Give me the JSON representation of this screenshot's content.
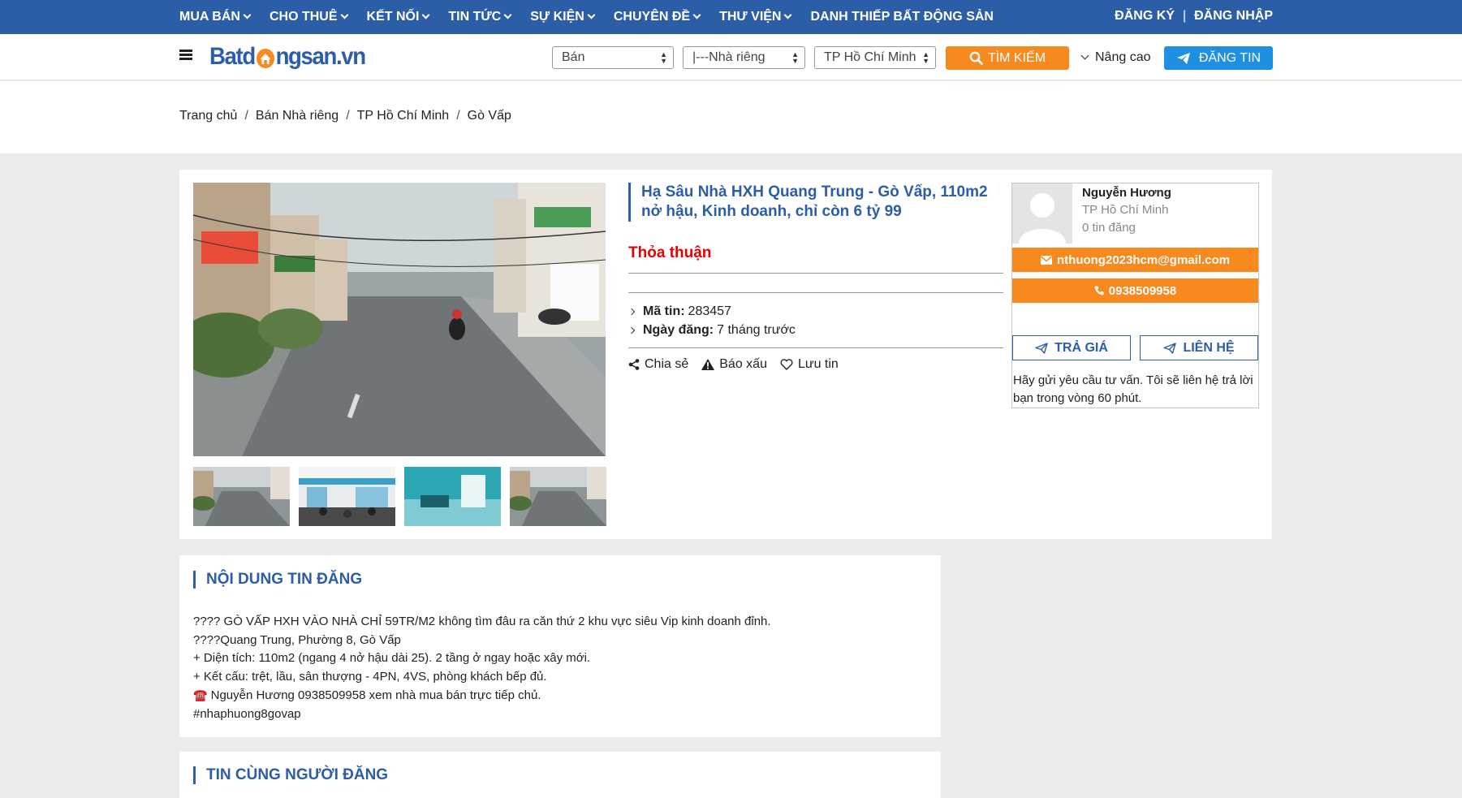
{
  "topnav": {
    "menu": [
      {
        "label": "MUA BÁN",
        "dropdown": true
      },
      {
        "label": "CHO THUÊ",
        "dropdown": true
      },
      {
        "label": "KẾT NỐI",
        "dropdown": true
      },
      {
        "label": "TIN TỨC",
        "dropdown": true
      },
      {
        "label": "SỰ KIỆN",
        "dropdown": true
      },
      {
        "label": "CHUYÊN ĐỀ",
        "dropdown": true
      },
      {
        "label": "THƯ VIỆN",
        "dropdown": true
      },
      {
        "label": "DANH THIẾP BẤT ĐỘNG SẢN",
        "dropdown": false
      }
    ],
    "register": "ĐĂNG KÝ",
    "separator": "|",
    "login": "ĐĂNG NHẬP"
  },
  "header": {
    "logo": {
      "part1": "Batd",
      "part2": "ngsan.vn"
    },
    "filters": [
      {
        "value": "Bán"
      },
      {
        "value": "|---Nhà riêng"
      },
      {
        "value": "TP Hồ Chí Minh"
      }
    ],
    "search_label": "TÌM KIẾM",
    "advanced_label": "Nâng cao",
    "post_label": "ĐĂNG TIN"
  },
  "breadcrumb": {
    "items": [
      "Trang chủ",
      "Bán Nhà riêng",
      "TP Hồ Chí Minh",
      "Gò Vấp"
    ],
    "separator": "/"
  },
  "listing": {
    "title": "Hạ Sâu Nhà HXH Quang Trung - Gò Vấp, 110m2 nở hậu, Kinh doanh, chỉ còn 6 tỷ 99",
    "price": "Thỏa thuận",
    "id_label": "Mã tin:",
    "id_value": "283457",
    "date_label": "Ngày đăng:",
    "date_value": "7 tháng trước",
    "actions": {
      "share": "Chia sẻ",
      "report": "Báo xấu",
      "save": "Lưu tin"
    }
  },
  "agent": {
    "name": "Nguyễn Hương",
    "city": "TP Hồ Chí Minh",
    "post_count": "0 tin đăng",
    "email": "nthuong2023hcm@gmail.com",
    "phone": "0938509958",
    "offer_label": "TRẢ GIÁ",
    "contact_label": "LIÊN HỆ",
    "note": "Hãy gửi yêu cầu tư vấn. Tôi sẽ liên hệ trả lời bạn trong vòng 60 phút."
  },
  "content": {
    "title": "NỘI DUNG TIN ĐĂNG",
    "lines": [
      "???? GÒ VẤP HXH VÀO NHÀ CHỈ 59TR/M2 không tìm đâu ra căn thứ 2 khu vực siêu Vip kinh doanh đỉnh.",
      "????Quang Trung, Phường 8, Gò Vấp",
      "+ Diện tích: 110m2 (ngang 4 nở hậu dài 25). 2 tầng ở ngay hoặc xây mới.",
      "+ Kết cấu: trệt, lầu, sân thượng - 4PN, 4VS, phòng khách bếp đủ.",
      "Nguyễn Hương 0938509958 xem nhà mua bán trực tiếp chủ.",
      "#nhaphuong8govap"
    ],
    "phone_emoji": "☎️"
  },
  "related": {
    "title": "TIN CÙNG NGƯỜI ĐĂNG"
  },
  "colors": {
    "nav_blue": "#2c5da7",
    "orange": "#f7891f",
    "post_blue": "#1e8fe1",
    "price_red": "#e60000"
  }
}
